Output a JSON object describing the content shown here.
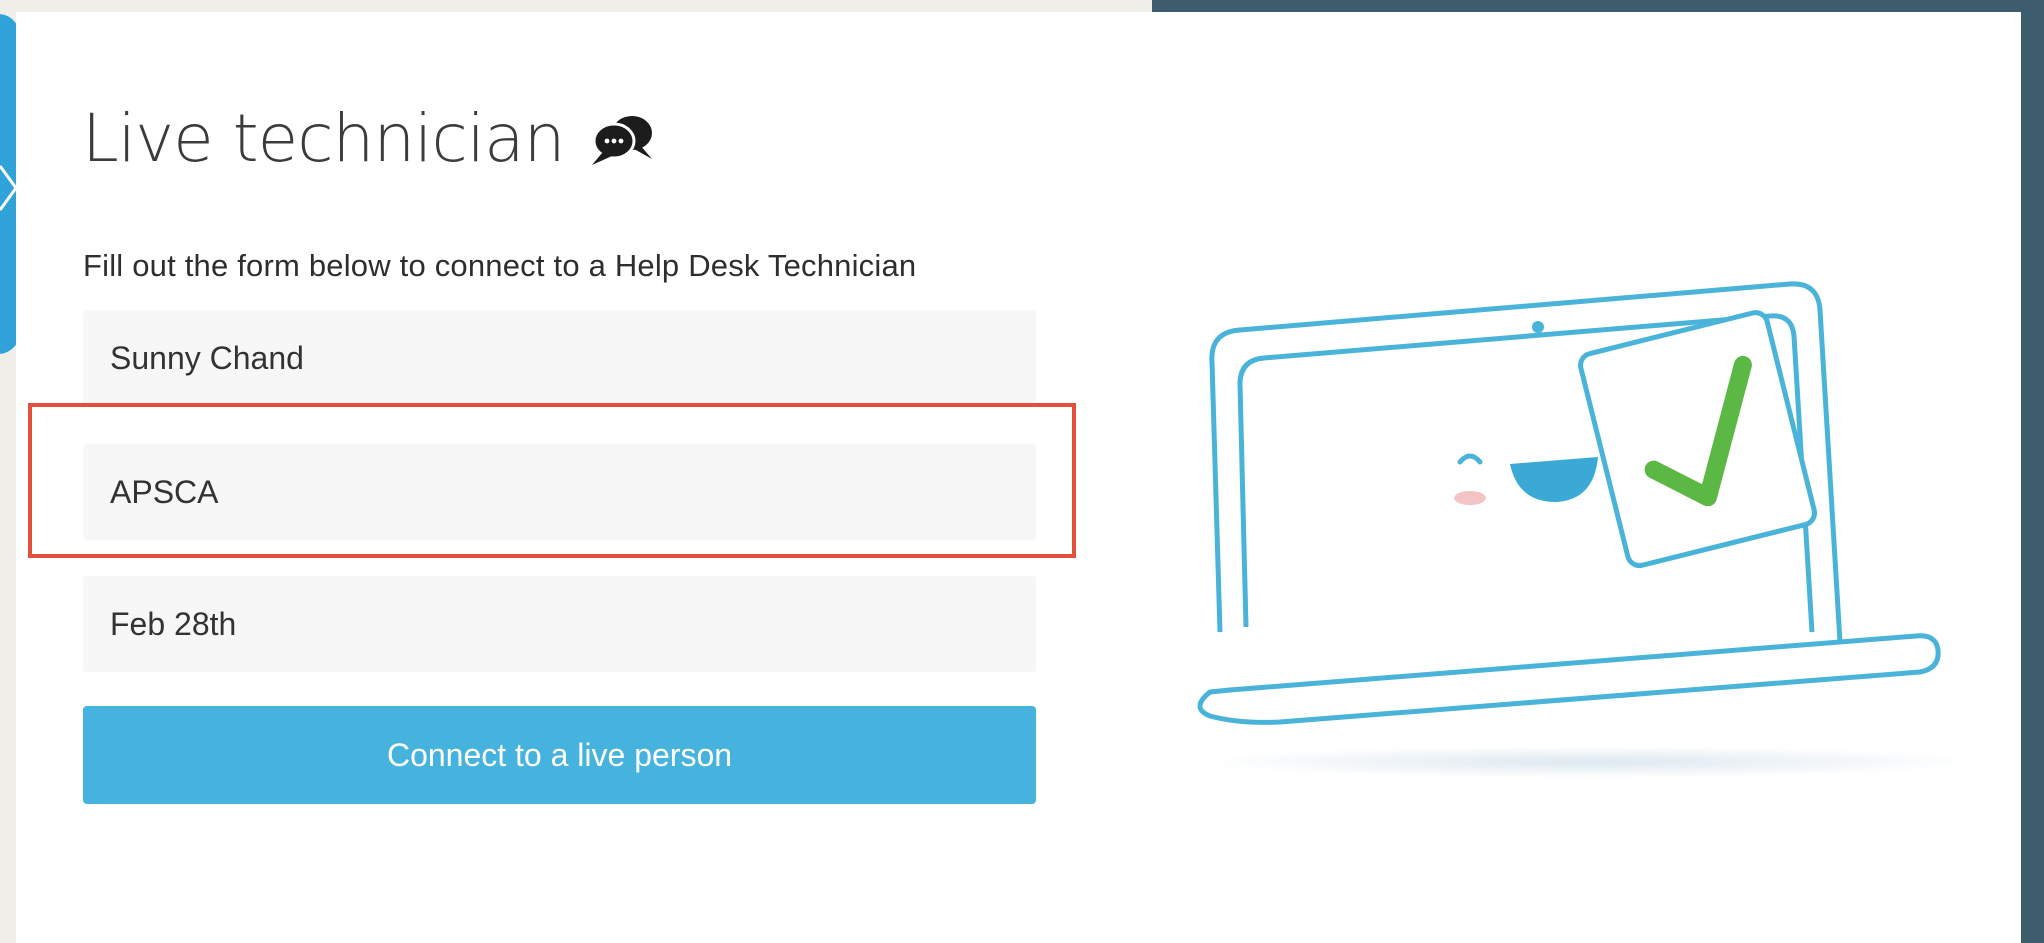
{
  "page": {
    "title": "Live technician",
    "subtitle": "Fill out the form below to connect to a Help Desk Technician"
  },
  "form": {
    "name_value": "Sunny Chand",
    "organization_value": "APSCA",
    "date_value": "Feb 28th",
    "connect_label": "Connect to a live person"
  },
  "icons": {
    "title_icon": "chat-bubbles-icon",
    "side_tab_icon": "chevron-right-icon"
  },
  "colors": {
    "accent": "#45b3dd",
    "highlight": "#e2503d",
    "side_tab": "#2fa2d8",
    "background_dark": "#3d5d6e",
    "illustration_stroke": "#4ab3d9",
    "check": "#5cb845"
  }
}
